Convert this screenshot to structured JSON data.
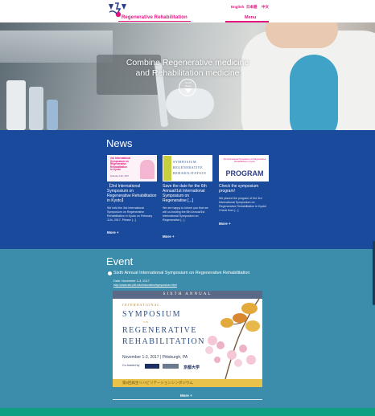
{
  "header": {
    "logo_text": "Regenerative Rehabilitation",
    "languages": [
      "English",
      "日本語",
      "中文"
    ],
    "menu_label": "Menu",
    "accent_color": "#e2127e"
  },
  "hero": {
    "headline_line1": "Combine Regenerative medicine",
    "headline_line2": "and Rehabilitation medicine",
    "scroll_label_line1": "Scroll",
    "scroll_label_line2": "Down"
  },
  "news": {
    "title": "News",
    "background_color": "#1a4a9c",
    "items": [
      {
        "title": "【3rd International Symposium on Regenerative Rehabilitation in Kyoto】",
        "body": "We held the 3rd International Symposium on Regenerative Rehabilitation in Kyoto on February 11th, 2017. Please [...]",
        "more": "More +",
        "thumb_lines": [
          "3rd International",
          "Symposium on",
          "Regenerative",
          "Rehabilitation",
          "in Kyoto"
        ],
        "thumb_date": "February 11th, 2017"
      },
      {
        "title": "Save the date for the 6th Annual/1st International Symposium on Regenerative [...]",
        "body": "We are happy to inform you that we will co-hosting the 6th Annual/1st International Symposium on Regenerative [...]",
        "more": "More +",
        "thumb_lines": [
          "SYMPOSIUM",
          "REGENERATIVE",
          "REHABILITATION"
        ]
      },
      {
        "title": "Check the symposium program!",
        "body": "We placed the program of the 3rd International Symposium on Regenerative Rehabilitation in Kyoto! Check from [...]",
        "more": "More +",
        "thumb_lines": [
          "3rd International Symposium on Regenerative Rehabilitation in Kyoto",
          "PROGRAM"
        ]
      }
    ]
  },
  "event": {
    "title": "Event",
    "background_color": "#3b8dab",
    "item_title": "Sixth Annual International Symposium on Regenerative Rehabilitation",
    "date": "Date: November 1-3, 2017",
    "url": "http://www.sirr.pitt.edu/education/symposium.html",
    "poster": {
      "top": "SIXTH ANNUAL",
      "international": "INTERNATIONAL",
      "symposium": "SYMPOSIUM",
      "on": "ON",
      "regenerative": "REGENERATIVE",
      "rehabilitation": "REHABILITATION",
      "date_place": "November 1-3, 2017 | Pittsburgh, PA",
      "cohosted": "Co-hosted by",
      "kyoto": "京都大学",
      "bottom": "第6回再生リハビリテーションシンポジウム"
    },
    "more": "More +"
  },
  "footer": {
    "strip_color": "#0fa083"
  }
}
